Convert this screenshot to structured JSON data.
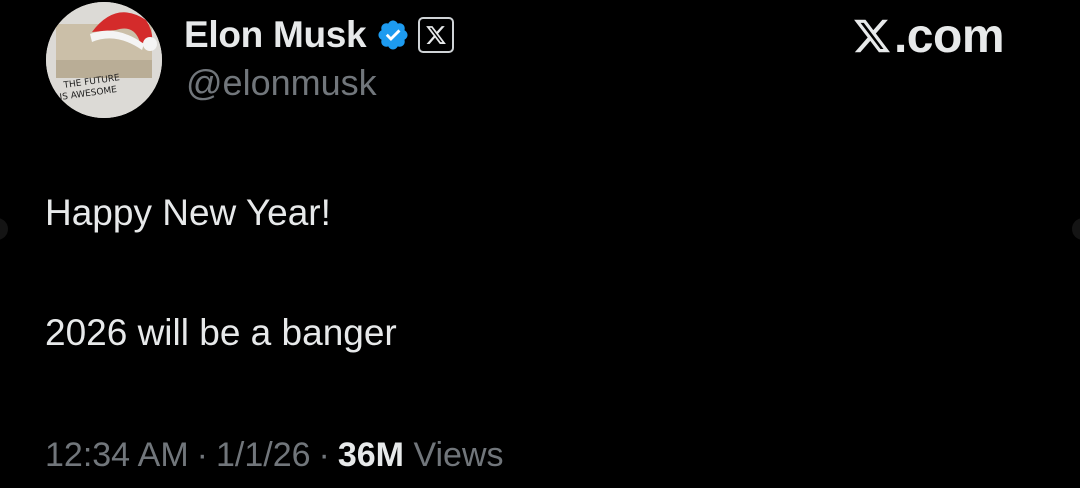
{
  "author": {
    "display_name": "Elon Musk",
    "handle": "@elonmusk",
    "avatar_icon": "avatar-christmas-hat-icon",
    "avatar_scribble_line_1": "THE FUTURE",
    "avatar_scribble_line_2": "IS AWESOME",
    "verified_icon": "verified-badge-icon",
    "affiliate_icon": "x-logo-icon"
  },
  "brand": {
    "icon": "x-logo-icon",
    "text": ".com"
  },
  "tweet": {
    "lines": [
      "Happy New Year!",
      "2026 will be a banger"
    ]
  },
  "meta": {
    "time": "12:34 AM",
    "separator": "·",
    "date": "1/1/26",
    "views_count": "36M",
    "views_label": "Views"
  },
  "colors": {
    "background": "#000000",
    "primary_text": "#e7e9ea",
    "secondary_text": "#71767b",
    "verified_blue": "#1d9bf0"
  }
}
